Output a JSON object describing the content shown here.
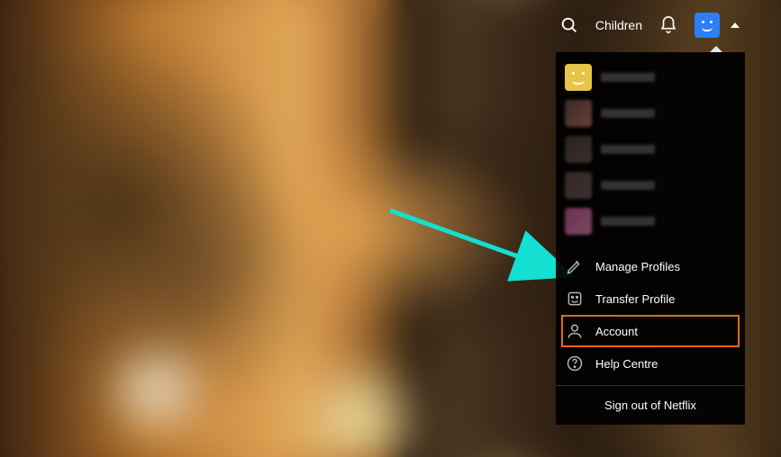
{
  "topbar": {
    "children_label": "Children"
  },
  "dropdown": {
    "profiles": [
      {
        "color": "yellow"
      },
      {
        "color": "blur1"
      },
      {
        "color": "blur2"
      },
      {
        "color": "blur3"
      },
      {
        "color": "blur4"
      }
    ],
    "menu": {
      "manage_profiles": "Manage Profiles",
      "transfer_profile": "Transfer Profile",
      "account": "Account",
      "help_centre": "Help Centre"
    },
    "signout": "Sign out of Netflix"
  },
  "highlight": {
    "target": "account",
    "border_color": "#e06a1c"
  },
  "arrow": {
    "color": "#14e0d1"
  }
}
